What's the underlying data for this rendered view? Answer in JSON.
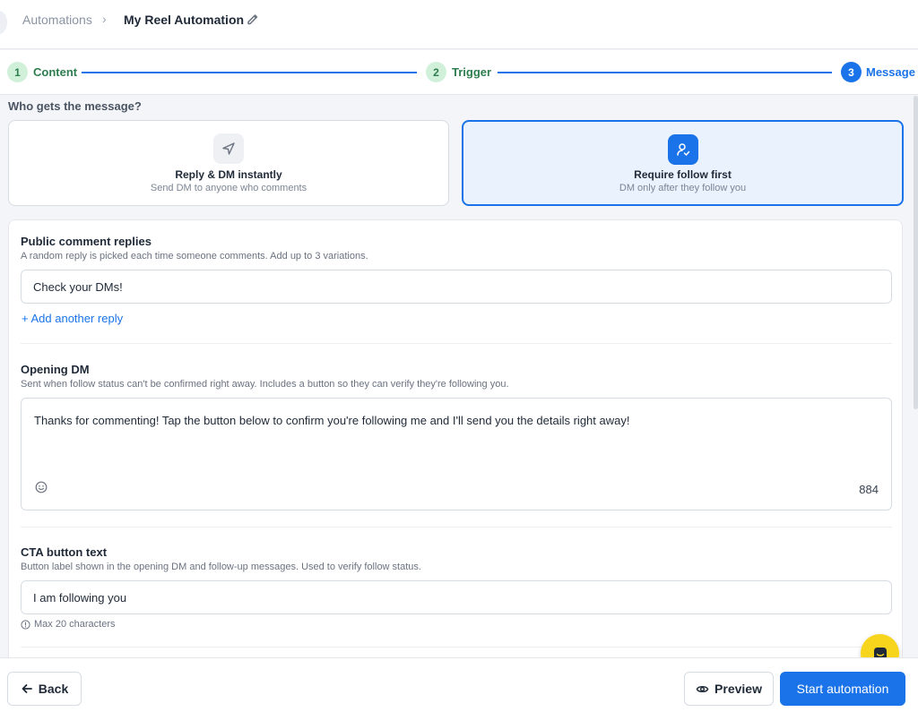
{
  "breadcrumb": {
    "root": "Automations",
    "separator": "›",
    "current": "My Reel Automation"
  },
  "stepper": {
    "steps": [
      {
        "number": "1",
        "label": "Content",
        "state": "done"
      },
      {
        "number": "2",
        "label": "Trigger",
        "state": "done"
      },
      {
        "number": "3",
        "label": "Message",
        "state": "active"
      }
    ]
  },
  "audience": {
    "question": "Who gets the message?",
    "options": [
      {
        "title": "Reply & DM instantly",
        "subtitle": "Send DM to anyone who comments",
        "icon": "send-icon",
        "selected": false
      },
      {
        "title": "Require follow first",
        "subtitle": "DM only after they follow you",
        "icon": "user-check-icon",
        "selected": true
      }
    ]
  },
  "public_replies": {
    "title": "Public comment replies",
    "help": "A random reply is picked each time someone comments. Add up to 3 variations.",
    "value": "Check your DMs!",
    "add_label": "+ Add another reply"
  },
  "opening_dm": {
    "title": "Opening DM",
    "help": "Sent when follow status can't be confirmed right away. Includes a button so they can verify they're following you.",
    "value": "Thanks for commenting! Tap the button below to confirm you're following me and I'll send you the details right away!",
    "char_count": "884"
  },
  "cta": {
    "title": "CTA button text",
    "help": "Button label shown in the opening DM and follow-up messages. Used to verify follow status.",
    "value": "I am following you",
    "hint": "Max 20 characters"
  },
  "footer": {
    "back_label": "Back",
    "preview_label": "Preview",
    "start_label": "Start automation"
  },
  "colors": {
    "accent": "#1a73e8",
    "done_step_bg": "#d1f0d9",
    "done_step_text": "#2e7d4f",
    "chat_bubble": "#f7d51d"
  }
}
